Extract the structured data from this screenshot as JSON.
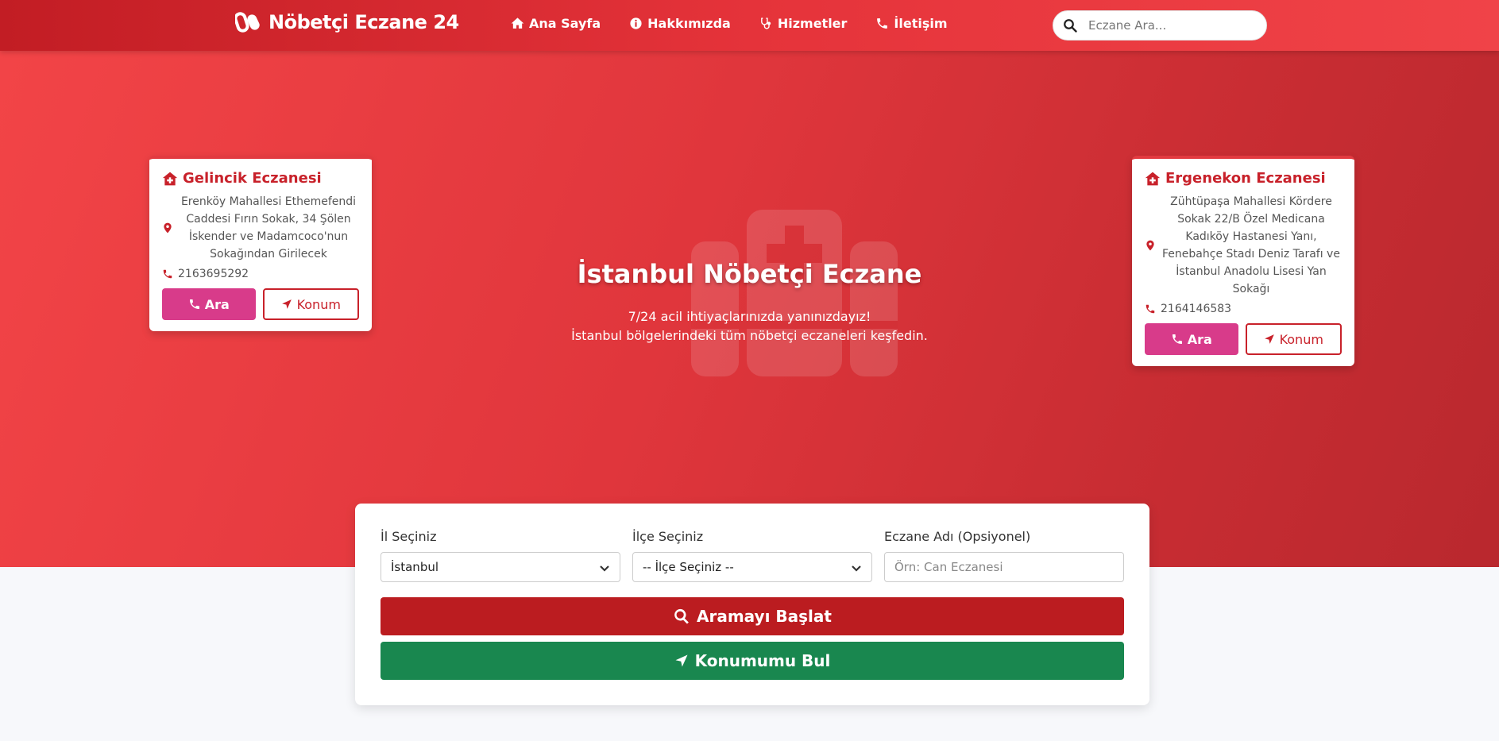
{
  "navbar": {
    "brand": "Nöbetçi Eczane 24",
    "brand_icon": "pills-icon",
    "items": [
      {
        "label": "Ana Sayfa",
        "icon": "home-icon"
      },
      {
        "label": "Hakkımızda",
        "icon": "info-circle-icon"
      },
      {
        "label": "Hizmetler",
        "icon": "stethoscope-icon"
      },
      {
        "label": "İletişim",
        "icon": "phone-icon"
      }
    ],
    "search_placeholder": "Eczane Ara..."
  },
  "hero": {
    "title": "İstanbul Nöbetçi Eczane",
    "subtitle_line1": "7/24 acil ihtiyaçlarınızda yanınızdayız!",
    "subtitle_line2": "İstanbul bölgelerindeki tüm nöbetçi eczaneleri keşfedin."
  },
  "cards": [
    {
      "name": "Gelincik Eczanesi",
      "address": "Erenköy Mahallesi Ethemefendi Caddesi Fırın Sokak, 34 Şölen İskender ve Madamcoco'nun Sokağından Girilecek",
      "phone": "2163695292",
      "call_label": "Ara",
      "location_label": "Konum"
    },
    {
      "name": "Ergenekon Eczanesi",
      "address": "Zühtüpaşa Mahallesi Kördere Sokak 22/B Özel Medicana Kadıköy Hastanesi Yanı, Fenebahçe Stadı Deniz Tarafı ve İstanbul Anadolu Lisesi Yan Sokağı",
      "phone": "2164146583",
      "call_label": "Ara",
      "location_label": "Konum"
    }
  ],
  "search_form": {
    "province_label": "İl Seçiniz",
    "province_value": "İstanbul",
    "district_label": "İlçe Seçiniz",
    "district_value": "-- İlçe Seçiniz --",
    "pharmacy_label": "Eczane Adı (Opsiyonel)",
    "pharmacy_placeholder": "Örn: Can Eczanesi",
    "search_button": "Aramayı Başlat",
    "locate_button": "Konumumu Bul"
  },
  "colors": {
    "primary_red": "#c8212a",
    "call_pink": "#d83b8a",
    "search_red": "#bb1c20",
    "locate_green": "#19874f"
  }
}
